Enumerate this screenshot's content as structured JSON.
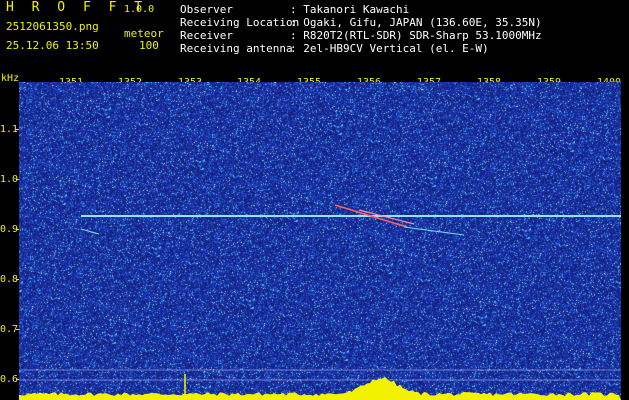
{
  "header": {
    "app_title": "H R O F F T",
    "app_version": "1.0.0",
    "filename": "2512061350.png",
    "mode": "meteor",
    "date_time": "25.12.06 13:50",
    "count": "100",
    "info": [
      {
        "label": "Observer",
        "value": ": Takanori Kawachi"
      },
      {
        "label": "Receiving Location",
        "value": ": Ogaki, Gifu, JAPAN (136.60E, 35.35N)"
      },
      {
        "label": "Receiver",
        "value": ": R820T2(RTL-SDR) SDR-Sharp 53.1000MHz"
      },
      {
        "label": "Receiving antenna",
        "value": ": 2el-HB9CV Vertical (el. E-W)"
      }
    ]
  },
  "axes": {
    "y_unit": "kHz",
    "y_ticks": [
      "1.1",
      "1.0",
      "0.9",
      "0.8",
      "0.7",
      "0.6"
    ],
    "x_ticks": [
      "1351",
      "1352",
      "1353",
      "1354",
      "1355",
      "1356",
      "1357",
      "1358",
      "1359",
      "1400"
    ]
  },
  "colors": {
    "background": "#000000",
    "label": "#f2f200",
    "text": "#ffffff",
    "spectrum_base": "#1a2a9a",
    "carrier": "#7fe0ff",
    "meteor": "#ff6060",
    "level_trace": "#f2f200"
  }
}
